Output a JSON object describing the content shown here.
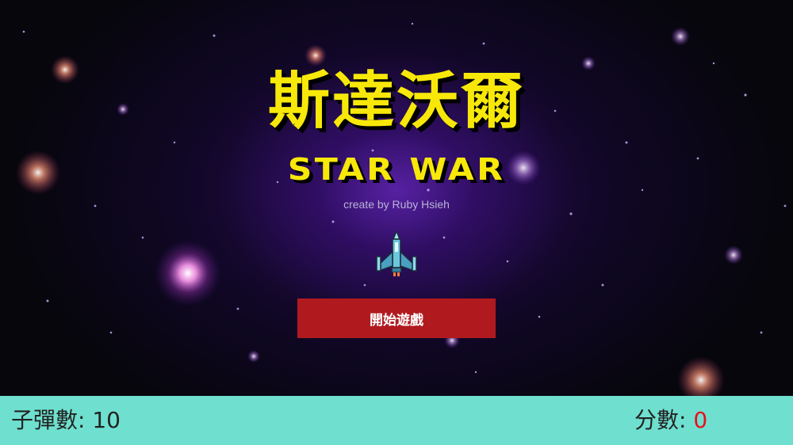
{
  "title_zh": "斯達沃爾",
  "title_en": "STAR WAR",
  "credit": "create by Ruby Hsieh",
  "ship_icon": "spaceship-icon",
  "start_button_label": "開始遊戲",
  "status": {
    "ammo_label": "子彈數:",
    "ammo_value": "10",
    "score_label": "分數:",
    "score_value": "0"
  },
  "colors": {
    "title": "#f7e80a",
    "button": "#b01a1f",
    "status_bar": "#6fe0cf",
    "score_value": "#e8101a"
  }
}
